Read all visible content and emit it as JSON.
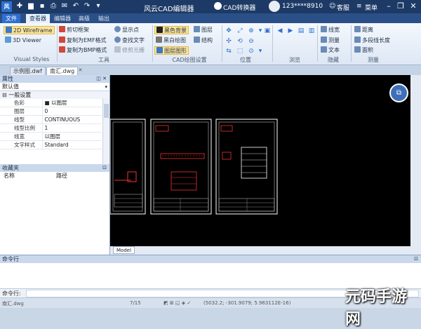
{
  "titlebar": {
    "app_icon": "风",
    "title": "风云CAD编辑器",
    "converter": "CAD转换器",
    "user": "123****8910",
    "service": "客服",
    "menu": "菜单"
  },
  "tabs": [
    "文件",
    "查看器",
    "编辑器",
    "高级",
    "输出"
  ],
  "ribbon": {
    "visual_styles": {
      "label": "Visual Styles",
      "items": [
        "2D Wireframe",
        "3D Viewer"
      ]
    },
    "tools": {
      "label": "工具",
      "items": [
        "剪切框架",
        "复制为EMF格式",
        "复制为BMP格式",
        "显示点",
        "查找文字",
        "修剪光栅"
      ]
    },
    "cad_settings": {
      "label": "CAD绘图设置",
      "items": [
        "黑色背景",
        "黑白绘图",
        "图层",
        "结构",
        "图层图形"
      ]
    },
    "position": {
      "label": "位置"
    },
    "browse": {
      "label": "浏览"
    },
    "hide": {
      "label": "隐藏",
      "items": [
        "线宽",
        "测量",
        "文本"
      ]
    },
    "measure": {
      "label": "测量",
      "items": [
        "距离",
        "多段线长度",
        "面积"
      ]
    }
  },
  "doc_tabs": [
    "示例图.dwf",
    "南汇.dwg"
  ],
  "properties": {
    "title": "属性",
    "combo": "默认值",
    "category": "一般设置",
    "rows": [
      {
        "key": "色彩",
        "value": "■ 以图层"
      },
      {
        "key": "图层",
        "value": "0"
      },
      {
        "key": "线型",
        "value": "CONTINUOUS"
      },
      {
        "key": "线型比例",
        "value": "1"
      },
      {
        "key": "线宽",
        "value": "以图层"
      },
      {
        "key": "文字样式",
        "value": "Standard"
      }
    ]
  },
  "favorites": {
    "title": "收藏夹",
    "col_name": "名称",
    "col_path": "路径"
  },
  "model_tab": "Model",
  "command": {
    "panel_title": "命令行",
    "prompt": "命令行:"
  },
  "status": {
    "file": "南汇.dwg",
    "pages": "7/15",
    "coords": "(5032.2; -301.9079; 5.963112E-16)"
  },
  "watermark": "元码手游网"
}
